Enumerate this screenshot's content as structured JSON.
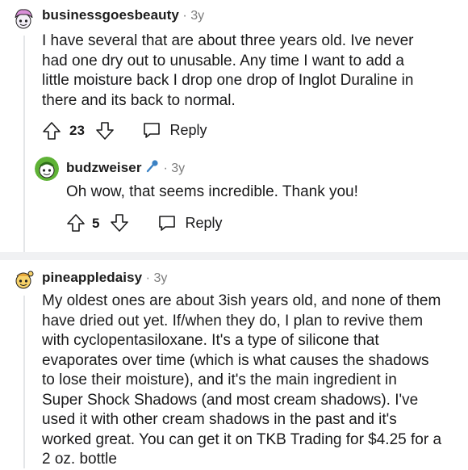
{
  "comments": [
    {
      "username": "businessgoesbeauty",
      "time": "3y",
      "lines": [
        "I have several that are about three years old. Ive never",
        "had one dry out to unusable. Any time I want to add a",
        "little moisture back I drop one drop of Inglot Duraline in",
        "there and its back to normal."
      ],
      "votes": "23",
      "reply_label": "Reply",
      "avatar_icon": "snoo-avatar-pink-hair-icon"
    },
    {
      "username": "budzweiser",
      "flair_icon": "microphone-icon",
      "time": "3y",
      "lines": [
        "Oh wow, that seems incredible. Thank you!"
      ],
      "votes": "5",
      "reply_label": "Reply",
      "avatar_icon": "snoo-avatar-green-icon"
    },
    {
      "username": "pineappledaisy",
      "time": "3y",
      "lines": [
        "My oldest ones are about 3ish years old, and none of them",
        "have dried out yet. If/when they do, I plan to revive them",
        "with cyclopentasiloxane. It's a type of silicone that",
        "evaporates over time (which is what causes the shadows",
        "to lose their moisture), and it's the main ingredient in",
        "Super Shock Shadows (and most cream shadows). I've",
        "used it with other cream shadows in the past and it's",
        "worked great. You can get it on TKB Trading for $4.25 for a",
        "2 oz. bottle"
      ],
      "avatar_icon": "snoo-avatar-yellow-icon"
    }
  ],
  "dot": "·"
}
